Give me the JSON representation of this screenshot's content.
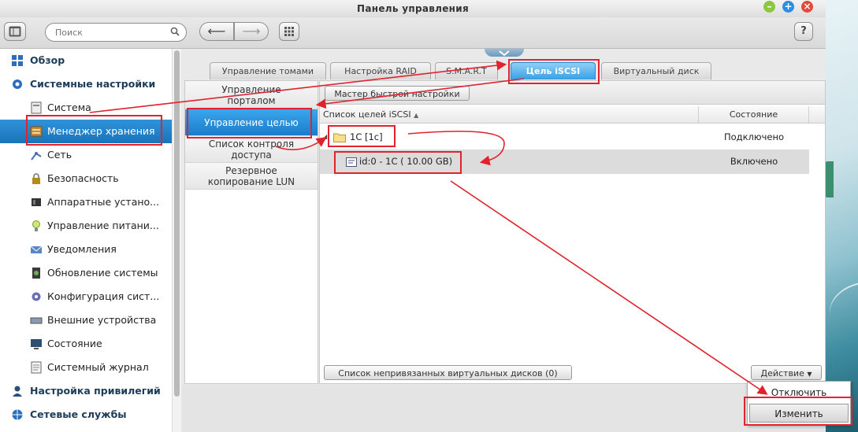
{
  "window": {
    "title": "Панель управления"
  },
  "toolbar": {
    "search_placeholder": "Поиск",
    "help_label": "?"
  },
  "sidebar": {
    "items": [
      {
        "label": "Обзор",
        "icon": "overview-icon",
        "level": "top"
      },
      {
        "label": "Системные настройки",
        "icon": "gear-icon",
        "level": "top"
      },
      {
        "label": "Система",
        "icon": "system-icon",
        "level": "sub"
      },
      {
        "label": "Менеджер хранения",
        "icon": "storage-icon",
        "level": "sub",
        "active": true
      },
      {
        "label": "Сеть",
        "icon": "network-icon",
        "level": "sub"
      },
      {
        "label": "Безопасность",
        "icon": "lock-icon",
        "level": "sub"
      },
      {
        "label": "Аппаратные устано...",
        "icon": "hardware-icon",
        "level": "sub"
      },
      {
        "label": "Управление питани...",
        "icon": "power-icon",
        "level": "sub"
      },
      {
        "label": "Уведомления",
        "icon": "notification-icon",
        "level": "sub"
      },
      {
        "label": "Обновление системы",
        "icon": "update-icon",
        "level": "sub"
      },
      {
        "label": "Конфигурация сист...",
        "icon": "config-icon",
        "level": "sub"
      },
      {
        "label": "Внешние устройства",
        "icon": "external-device-icon",
        "level": "sub"
      },
      {
        "label": "Состояние",
        "icon": "status-monitor-icon",
        "level": "sub"
      },
      {
        "label": "Системный журнал",
        "icon": "log-icon",
        "level": "sub"
      },
      {
        "label": "Настройка привилегий",
        "icon": "users-icon",
        "level": "top"
      },
      {
        "label": "Сетевые службы",
        "icon": "network-services-icon",
        "level": "top"
      }
    ]
  },
  "tabs": [
    {
      "label": "Управление томами"
    },
    {
      "label": "Настройка RAID"
    },
    {
      "label": "S.M.A.R.T"
    },
    {
      "label": "Цель iSCSI",
      "active": true
    },
    {
      "label": "Виртуальный диск"
    }
  ],
  "left_menu": [
    {
      "label": "Управление порталом"
    },
    {
      "label": "Управление целью",
      "active": true
    },
    {
      "label": "Список контроля доступа"
    },
    {
      "label": "Резервное копирование LUN"
    }
  ],
  "main": {
    "wizard_button": "Мастер быстрой настройки",
    "columns": {
      "name": "Список целей iSCSI",
      "status": "Состояние"
    },
    "rows": [
      {
        "name": "1C [1c]",
        "status": "Подключено",
        "type": "target"
      },
      {
        "name": "id:0 - 1C ( 10.00 GB)",
        "status": "Включено",
        "type": "lun"
      }
    ],
    "unbound_button": "Список непривязанных виртуальных дисков (0)",
    "action_button": "Действие"
  },
  "action_menu": {
    "items": [
      {
        "label": "Отключить"
      },
      {
        "label": "Изменить"
      }
    ]
  },
  "colors": {
    "accent": "#1a73b8",
    "annotation": "#e0232d"
  }
}
